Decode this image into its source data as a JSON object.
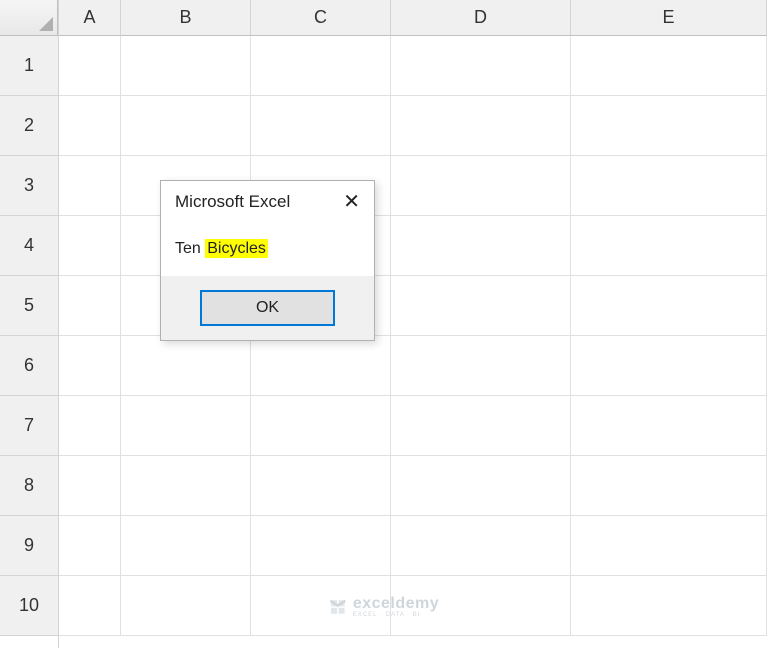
{
  "columns": [
    "A",
    "B",
    "C",
    "D",
    "E"
  ],
  "rows": [
    "1",
    "2",
    "3",
    "4",
    "5",
    "6",
    "7",
    "8",
    "9",
    "10"
  ],
  "dialog": {
    "title": "Microsoft Excel",
    "message_prefix": "Ten",
    "message_highlight": "Bicycles",
    "ok_label": "OK"
  },
  "watermark": {
    "main": "exceldemy",
    "sub": "EXCEL · DATA · BI"
  }
}
